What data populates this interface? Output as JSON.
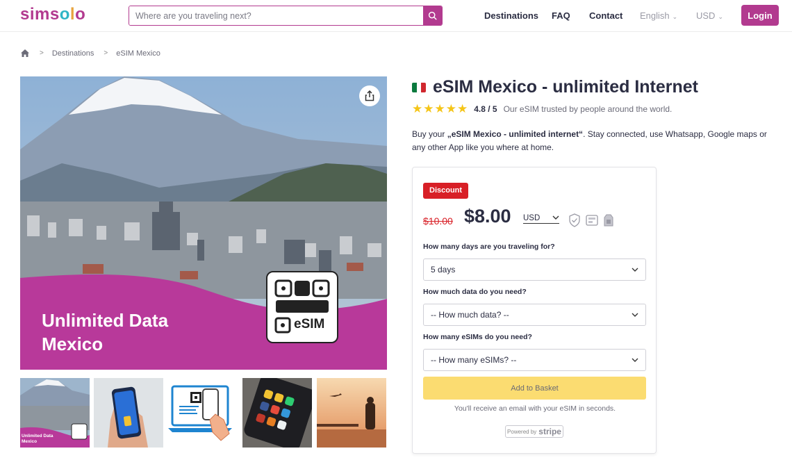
{
  "header": {
    "logo": "simsolo",
    "search_placeholder": "Where are you traveling next?",
    "nav": [
      "Destinations",
      "FAQ",
      "Contact"
    ],
    "language": "English",
    "currency": "USD",
    "login_label": "Login"
  },
  "breadcrumb": {
    "items": [
      "Destinations",
      "eSIM Mexico"
    ]
  },
  "hero": {
    "line1": "Unlimited Data",
    "line2": "Mexico",
    "badge": "eSIM"
  },
  "thumbs": {
    "first_caption_line1": "Unlimited Data",
    "first_caption_line2": "Mexico"
  },
  "product": {
    "title": "eSIM Mexico - unlimited Internet",
    "rating_score": "4.8 / 5",
    "rating_value": 4.8,
    "rating_text": "Our eSIM trusted by people around the world.",
    "description_prefix": "Buy your ",
    "description_bold": "„eSIM Mexico - unlimited internet“",
    "description_suffix": ". Stay connected, use Whatsapp, Google maps or any other App like you where at home."
  },
  "purchase": {
    "discount_label": "Discount",
    "old_price": "$10.00",
    "new_price": "$8.00",
    "currency": "USD",
    "days_label": "How many days are you traveling for?",
    "days_value": "5 days",
    "data_label": "How much data do you need?",
    "data_value": "-- How much data? --",
    "esims_label": "How many eSIMs do you need?",
    "esims_value": "-- How many eSIMs? --",
    "basket_label": "Add to Basket",
    "email_note": "You'll receive an email with your eSIM in seconds.",
    "stripe_prefix": "Powered by",
    "stripe_name": "stripe"
  },
  "colors": {
    "brand": "#b23a8f",
    "discount": "#d81f26",
    "basket": "#fbdc71",
    "star": "#f5c518"
  }
}
